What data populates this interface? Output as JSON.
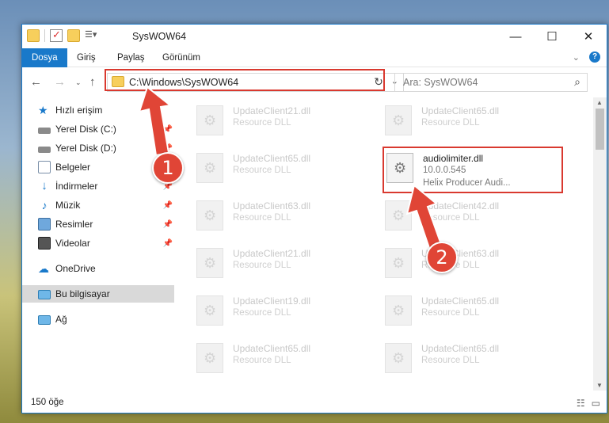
{
  "window": {
    "title": "SysWOW64",
    "controls": {
      "minimize": "—",
      "maximize": "☐",
      "close": "✕"
    }
  },
  "ribbon": {
    "tabs": [
      "Dosya",
      "Giriş",
      "Paylaş",
      "Görünüm"
    ],
    "active_tab": "Dosya",
    "collapse_icon": "chevron-down-icon",
    "help_label": "?"
  },
  "address": {
    "path": "C:\\Windows\\SysWOW64",
    "search_placeholder": "Ara: SysWOW64"
  },
  "sidebar": {
    "items": [
      {
        "label": "Hızlı erişim",
        "icon": "star-icon"
      },
      {
        "label": "Yerel Disk (C:)",
        "icon": "drive-icon",
        "pinned": true
      },
      {
        "label": "Yerel Disk (D:)",
        "icon": "drive-icon",
        "pinned": true
      },
      {
        "label": "Belgeler",
        "icon": "documents-icon",
        "pinned": true
      },
      {
        "label": "İndirmeler",
        "icon": "download-icon",
        "pinned": true
      },
      {
        "label": "Müzik",
        "icon": "music-icon",
        "pinned": true
      },
      {
        "label": "Resimler",
        "icon": "pictures-icon",
        "pinned": true
      },
      {
        "label": "Videolar",
        "icon": "videos-icon",
        "pinned": true
      },
      {
        "label": "OneDrive",
        "icon": "cloud-icon"
      },
      {
        "label": "Bu bilgisayar",
        "icon": "computer-icon",
        "selected": true
      },
      {
        "label": "Ağ",
        "icon": "network-icon"
      }
    ]
  },
  "files": [
    {
      "name": "UpdateClient21.dll",
      "desc": "Resource DLL"
    },
    {
      "name": "UpdateClient65.dll",
      "desc": "Resource DLL"
    },
    {
      "name": "UpdateClient65.dll",
      "desc": "Resource DLL"
    },
    {
      "name": "audiolimiter.dll",
      "desc": "10.0.0.545",
      "desc2": "Helix Producer Audi...",
      "highlighted": true
    },
    {
      "name": "UpdateClient63.dll",
      "desc": "Resource DLL"
    },
    {
      "name": "UpdateClient42.dll",
      "desc": "Resource DLL"
    },
    {
      "name": "UpdateClient21.dll",
      "desc": "Resource DLL"
    },
    {
      "name": "UpdateClient63.dll",
      "desc": "Resource DLL"
    },
    {
      "name": "UpdateClient19.dll",
      "desc": "Resource DLL"
    },
    {
      "name": "UpdateClient65.dll",
      "desc": "Resource DLL"
    },
    {
      "name": "UpdateClient65.dll",
      "desc": "Resource DLL"
    },
    {
      "name": "UpdateClient65.dll",
      "desc": "Resource DLL"
    }
  ],
  "status": {
    "count": "150 öğe"
  },
  "annotations": {
    "marker1": "1",
    "marker2": "2",
    "color": "#e04536"
  },
  "colors": {
    "accent": "#1979ca",
    "highlight_box": "#d9392f"
  }
}
